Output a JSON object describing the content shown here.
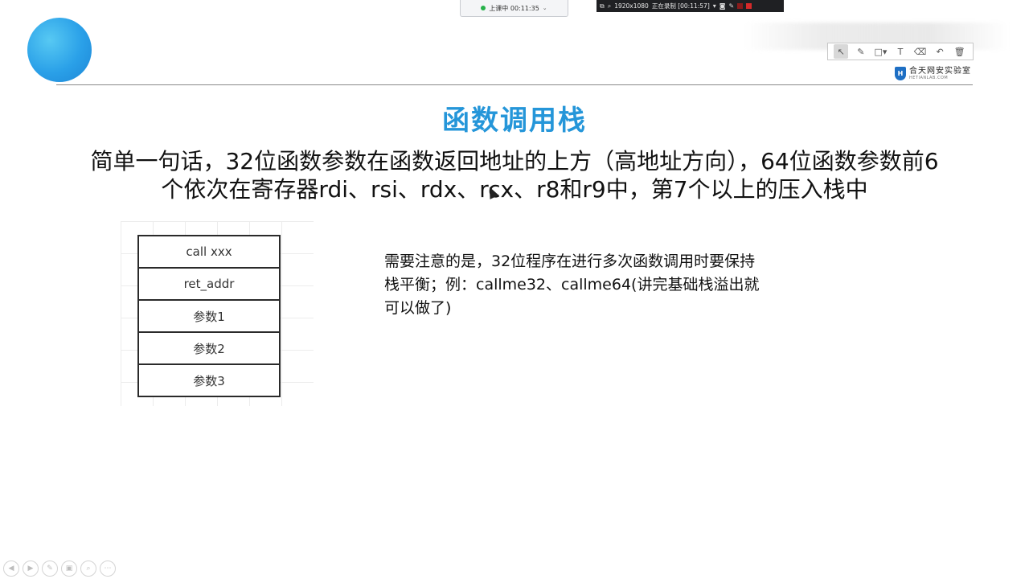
{
  "class_status": {
    "label": "上课中 00:11:35"
  },
  "recorder": {
    "resolution": "1920x1080",
    "status": "正在录制 [00:11:57]"
  },
  "brand": {
    "name": "合天网安实验室",
    "sub": "HETIANLAB.COM"
  },
  "annotation_tools": [
    {
      "name": "select",
      "icon": "↖"
    },
    {
      "name": "pen",
      "icon": "✎"
    },
    {
      "name": "shape",
      "icon": "□▾"
    },
    {
      "name": "text",
      "icon": "T"
    },
    {
      "name": "eraser",
      "icon": "⌫"
    },
    {
      "name": "undo",
      "icon": "↶"
    },
    {
      "name": "delete",
      "icon": "🗑"
    }
  ],
  "slide": {
    "title": "函数调用栈",
    "main_text": "简单一句话，32位函数参数在函数返回地址的上方（高地址方向），64位函数参数前6个依次在寄存器rdi、rsi、rdx、rcx、r8和r9中，第7个以上的压入栈中",
    "note_text": "需要注意的是，32位程序在进行多次函数调用时要保持栈平衡；例：callme32、callme64(讲完基础栈溢出就可以做了)",
    "stack": [
      "call xxx",
      "ret_addr",
      "参数1",
      "参数2",
      "参数3"
    ]
  },
  "bottom_nav": [
    "◀",
    "▶",
    "✎",
    "▣",
    "⌕",
    "⋯"
  ]
}
